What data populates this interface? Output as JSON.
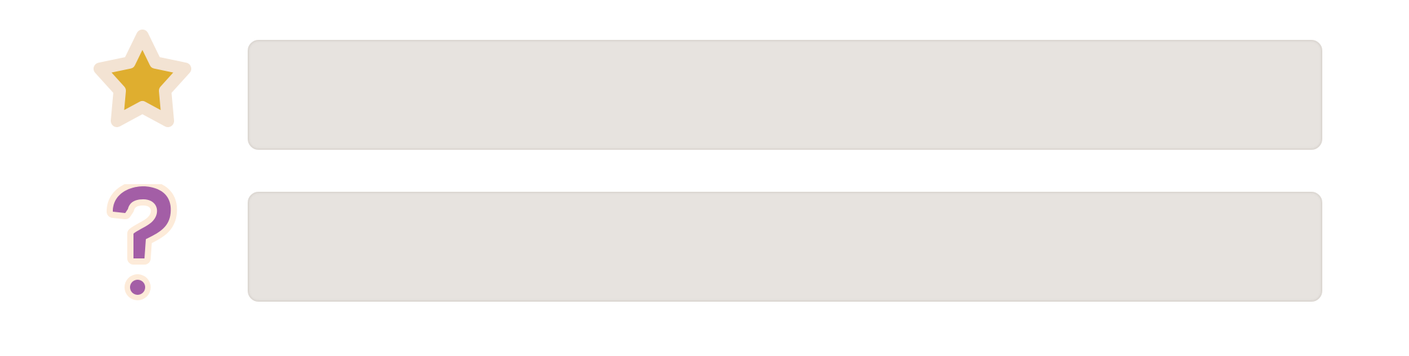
{
  "colors": {
    "background": "#ffffff",
    "bar_fill": "#e7e3df",
    "star_fill": "#dfae2f",
    "star_outline": "#f3e3d3",
    "question_fill": "#a35ea6",
    "question_outline": "#fdebd9"
  },
  "rows": [
    {
      "icon": "star-icon",
      "text": ""
    },
    {
      "icon": "question-mark-icon",
      "text": ""
    }
  ]
}
